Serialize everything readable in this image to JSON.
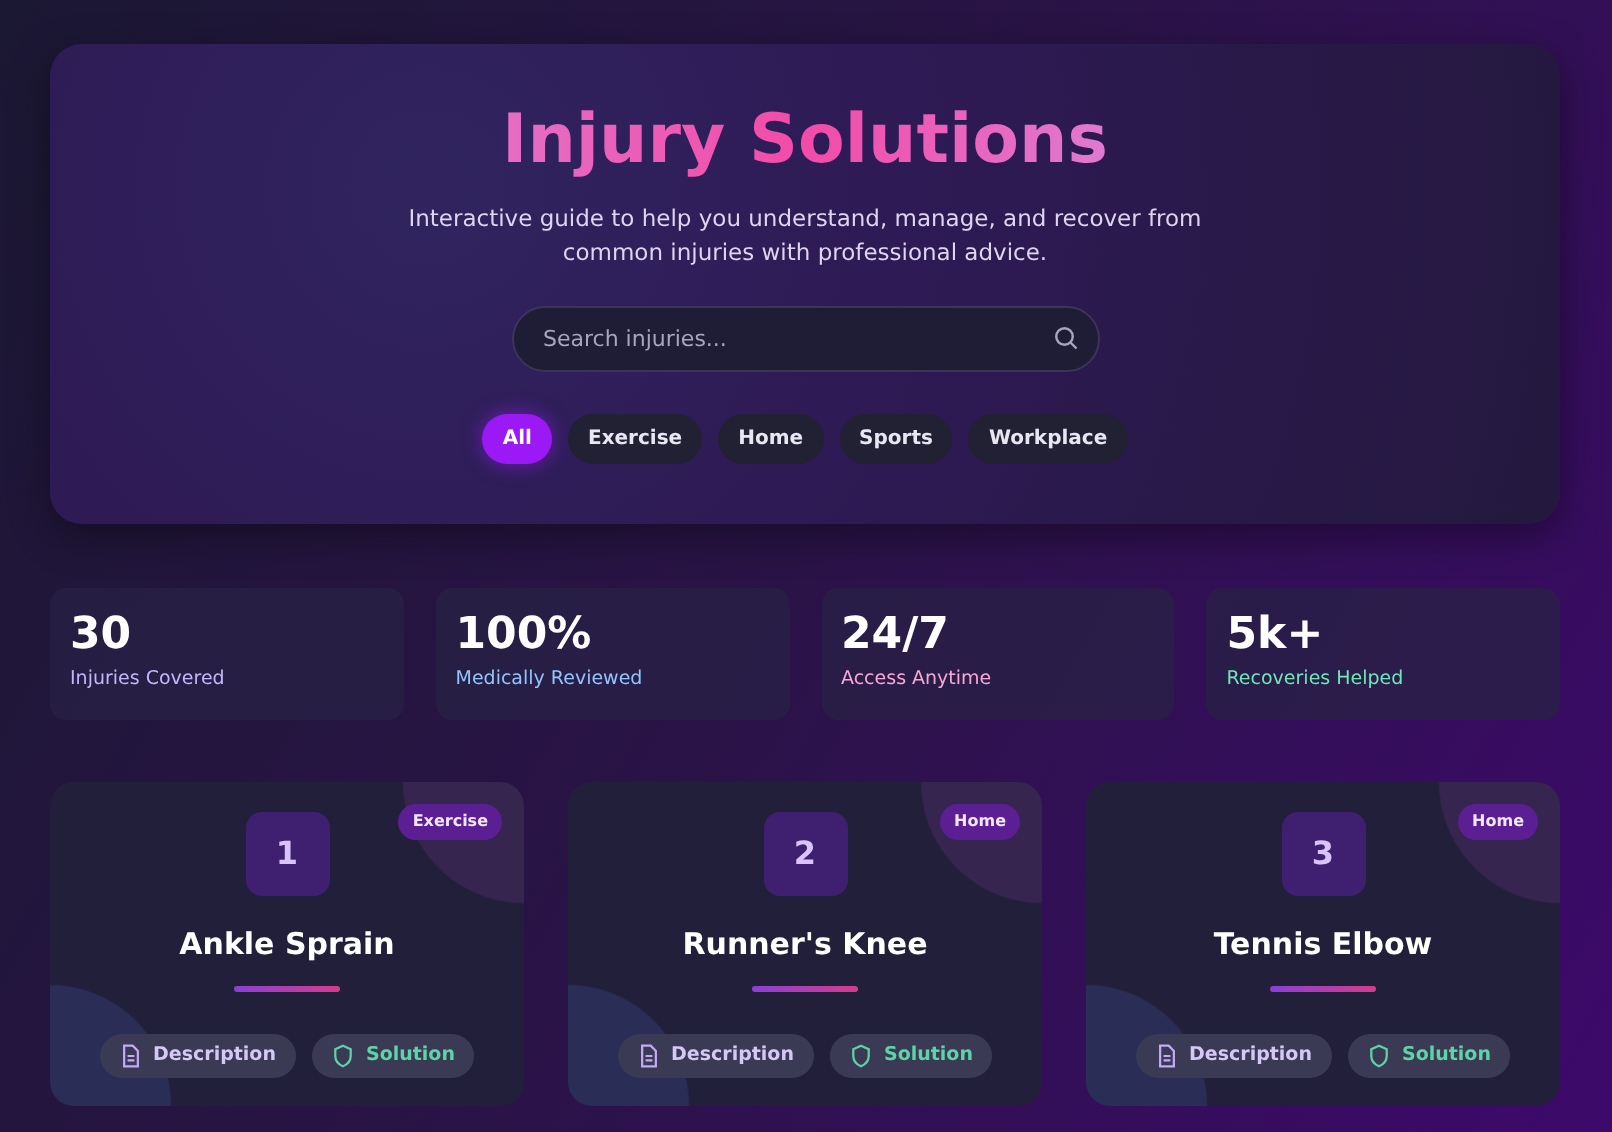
{
  "hero": {
    "title": "Injury Solutions",
    "subtitle": "Interactive guide to help you understand, manage, and recover from common injuries with professional advice.",
    "search": {
      "placeholder": "Search injuries..."
    },
    "filters": [
      {
        "label": "All",
        "selected": true
      },
      {
        "label": "Exercise",
        "selected": false
      },
      {
        "label": "Home",
        "selected": false
      },
      {
        "label": "Sports",
        "selected": false
      },
      {
        "label": "Workplace",
        "selected": false
      }
    ]
  },
  "stats": [
    {
      "value": "30",
      "label": "Injuries Covered",
      "color": "#c4b5fd"
    },
    {
      "value": "100%",
      "label": "Medically Reviewed",
      "color": "#93c5fd"
    },
    {
      "value": "24/7",
      "label": "Access Anytime",
      "color": "#f9a8d4"
    },
    {
      "value": "5k+",
      "label": "Recoveries Helped",
      "color": "#6ee7b7"
    }
  ],
  "injuries": [
    {
      "number": "1",
      "title": "Ankle Sprain",
      "tag": "Exercise",
      "buttons": [
        "Description",
        "Solution"
      ]
    },
    {
      "number": "2",
      "title": "Runner's Knee",
      "tag": "Home",
      "buttons": [
        "Description",
        "Solution"
      ]
    },
    {
      "number": "3",
      "title": "Tennis Elbow",
      "tag": "Home",
      "buttons": [
        "Description",
        "Solution"
      ]
    }
  ]
}
